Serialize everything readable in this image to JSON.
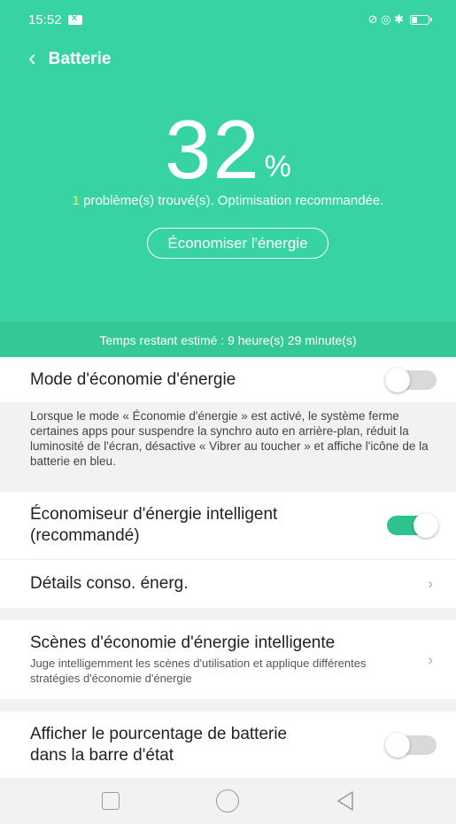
{
  "status": {
    "time": "15:52",
    "icons": "⊘ ◎ ✱"
  },
  "appbar": {
    "back_glyph": "‹",
    "title": "Batterie"
  },
  "battery": {
    "percent": "32",
    "percent_sign": "%",
    "problem_count": "1",
    "problem_text": " problème(s) trouvé(s). Optimisation recommandée.",
    "save_button": "Économiser l'énergie",
    "time_left": "Temps restant estimé : 9 heure(s) 29 minute(s)"
  },
  "settings": {
    "power_saving_mode": {
      "label": "Mode d'économie d'énergie",
      "enabled": false
    },
    "power_saving_desc": "Lorsque le mode « Économie d'énergie » est activé, le système ferme certaines apps pour suspendre la synchro auto en arrière-plan, réduit la luminosité de l'écran, désactive « Vibrer au toucher » et affiche l'icône de la batterie en bleu.",
    "smart_saver": {
      "label_line1": "Économiseur d'énergie intelligent",
      "label_line2": "(recommandé)",
      "enabled": true
    },
    "consumption_details": {
      "label": "Détails conso. énerg."
    },
    "smart_scenes": {
      "label": "Scènes d'économie d'énergie intelligente",
      "sub": "Juge intelligemment les scènes d'utilisation et applique différentes stratégies d'économie d'énergie"
    },
    "show_percentage": {
      "label_line1": "Afficher le pourcentage de batterie",
      "label_line2": "dans la barre d'état",
      "enabled": false
    },
    "chevron": "›"
  },
  "colors": {
    "accent": "#37d3a2",
    "toggle_on": "#2dc38c",
    "problem_count": "#f4e66c"
  }
}
